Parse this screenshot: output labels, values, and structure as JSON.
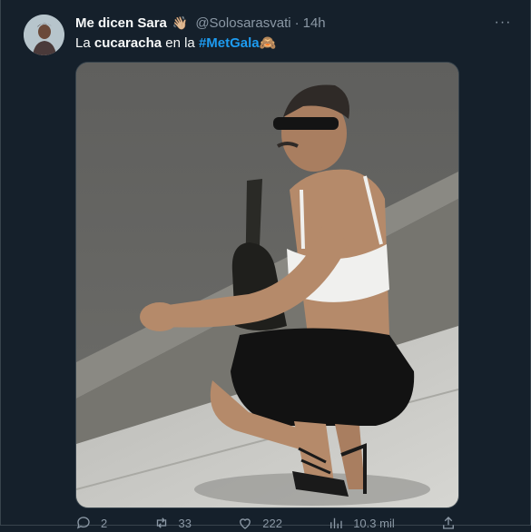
{
  "tweet": {
    "author_name": "Me dicen Sara",
    "author_emoji": "👋🏼",
    "handle": "@Solosarasvati",
    "separator": "·",
    "time": "14h",
    "more_label": "···",
    "text_prefix": "La ",
    "text_bold": "cucaracha",
    "text_middle": " en la ",
    "hashtag": "#MetGala",
    "text_emoji": "🙈"
  },
  "actions": {
    "reply_count": "2",
    "retweet_count": "33",
    "like_count": "222",
    "views_count": "10.3 mil"
  },
  "colors": {
    "background": "#15202b",
    "accent": "#1d9bf0",
    "muted": "#8b98a5"
  },
  "icons": [
    "reply-icon",
    "retweet-icon",
    "like-icon",
    "views-icon",
    "share-icon",
    "more-icon"
  ]
}
